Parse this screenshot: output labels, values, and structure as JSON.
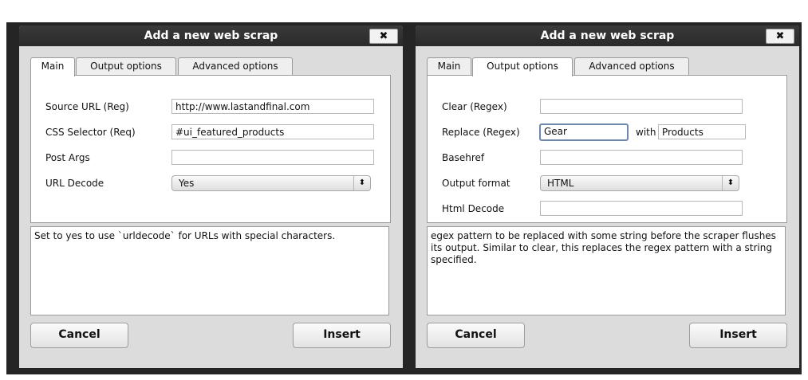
{
  "left_dialog": {
    "title": "Add a new web scrap",
    "close_label": "✖",
    "tabs": [
      "Main",
      "Output options",
      "Advanced options"
    ],
    "fields": {
      "source_url_label": "Source URL (Reg)",
      "source_url_value": "http://www.lastandfinal.com",
      "css_selector_label": "CSS Selector (Req)",
      "css_selector_value": "#ui_featured_products",
      "post_args_label": "Post Args",
      "post_args_value": "",
      "url_decode_label": "URL Decode",
      "url_decode_value": "Yes"
    },
    "help_text": "Set to yes to use `urldecode` for URLs with special characters.",
    "cancel_label": "Cancel",
    "insert_label": "Insert"
  },
  "right_dialog": {
    "title": "Add a new web scrap",
    "close_label": "✖",
    "tabs": [
      "Main",
      "Output options",
      "Advanced options"
    ],
    "fields": {
      "clear_label": "Clear (Regex)",
      "clear_value": "",
      "replace_label": "Replace (Regex)",
      "replace_value": "Gear",
      "with_label": "with",
      "with_value": "Products",
      "basehref_label": "Basehref",
      "basehref_value": "",
      "output_format_label": "Output format",
      "output_format_value": "HTML",
      "html_decode_label": "Html Decode",
      "html_decode_value": ""
    },
    "help_text": "egex pattern to be replaced with some string before the scraper flushes its output. Similar to clear, this replaces the regex pattern with a string specified.",
    "cancel_label": "Cancel",
    "insert_label": "Insert"
  },
  "icons": {
    "select_arrow": "⬍"
  }
}
